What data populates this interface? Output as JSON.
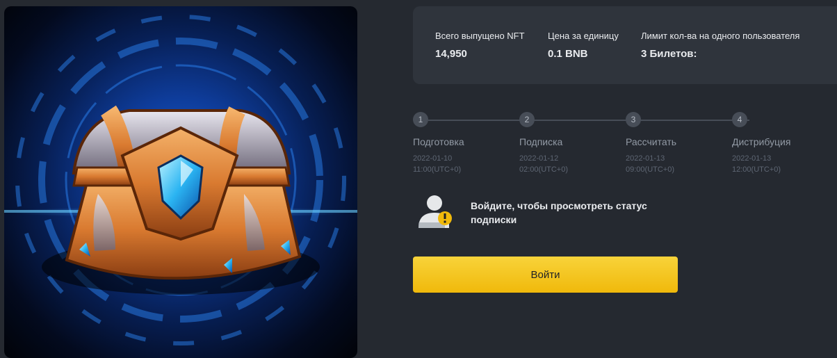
{
  "stats": [
    {
      "label": "Всего выпущено NFT",
      "value": "14,950"
    },
    {
      "label": "Цена за единицу",
      "value": "0.1 BNB"
    },
    {
      "label": "Лимит кол-ва на одного пользователя",
      "value": "3 Билетов:"
    }
  ],
  "steps": [
    {
      "num": "1",
      "title": "Подготовка",
      "date": "2022-01-10",
      "time": "11:00(UTC+0)"
    },
    {
      "num": "2",
      "title": "Подписка",
      "date": "2022-01-12",
      "time": "02:00(UTC+0)"
    },
    {
      "num": "3",
      "title": "Рассчитать",
      "date": "2022-01-13",
      "time": "09:00(UTC+0)"
    },
    {
      "num": "4",
      "title": "Дистрибуция",
      "date": "2022-01-13",
      "time": "12:00(UTC+0)"
    }
  ],
  "login_status": {
    "message": "Войдите, чтобы просмотреть статус подписки",
    "icon": "user-warning-icon"
  },
  "login_button": {
    "label": "Войти"
  },
  "colors": {
    "accent": "#f0b90b",
    "background": "#252930",
    "panel": "#2f343c"
  },
  "artwork": {
    "icon": "treasure-chest-nft"
  }
}
